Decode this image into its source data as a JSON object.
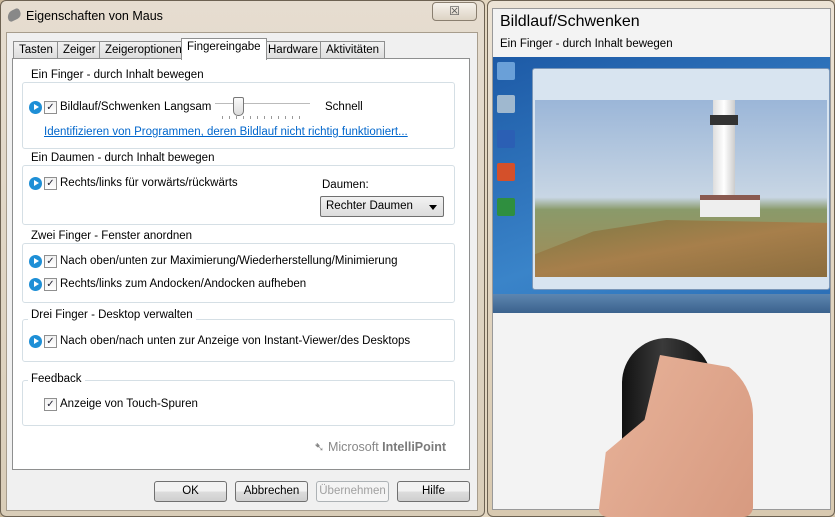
{
  "window": {
    "title": "Eigenschaften von Maus",
    "close": "☒"
  },
  "tabs": [
    "Tasten",
    "Zeiger",
    "Zeigeroptionen",
    "Fingereingabe",
    "Hardware",
    "Aktivitäten"
  ],
  "active_tab": "Fingereingabe",
  "groups": {
    "one_finger": {
      "legend": "Ein Finger  -  durch Inhalt bewegen",
      "option": "Bildlauf/Schwenken",
      "checked": true,
      "slow": "Langsam",
      "fast": "Schnell",
      "speed_fraction": 0.2,
      "link": "Identifizieren von Programmen, deren Bildlauf nicht richtig funktioniert..."
    },
    "thumb": {
      "legend": "Ein Daumen - durch Inhalt bewegen",
      "option": "Rechts/links für vorwärts/rückwärts",
      "checked": true,
      "select_label": "Daumen:",
      "select_value": "Rechter Daumen"
    },
    "two_fingers": {
      "legend": "Zwei Finger - Fenster anordnen",
      "options": [
        "Nach oben/unten zur Maximierung/Wiederherstellung/Minimierung",
        "Rechts/links zum Andocken/Andocken aufheben"
      ]
    },
    "three_fingers": {
      "legend": "Drei Finger - Desktop verwalten",
      "option": "Nach oben/nach unten zur Anzeige von Instant-Viewer/des Desktops"
    },
    "feedback": {
      "legend": "Feedback",
      "option": "Anzeige von Touch-Spuren"
    }
  },
  "logo": {
    "brand": "Microsoft",
    "product": "IntelliPoint"
  },
  "buttons": {
    "ok": "OK",
    "cancel": "Abbrechen",
    "apply": "Übernehmen",
    "help": "Hilfe"
  },
  "preview": {
    "title": "Bildlauf/Schwenken",
    "subtitle": "Ein Finger  -  durch Inhalt bewegen"
  }
}
